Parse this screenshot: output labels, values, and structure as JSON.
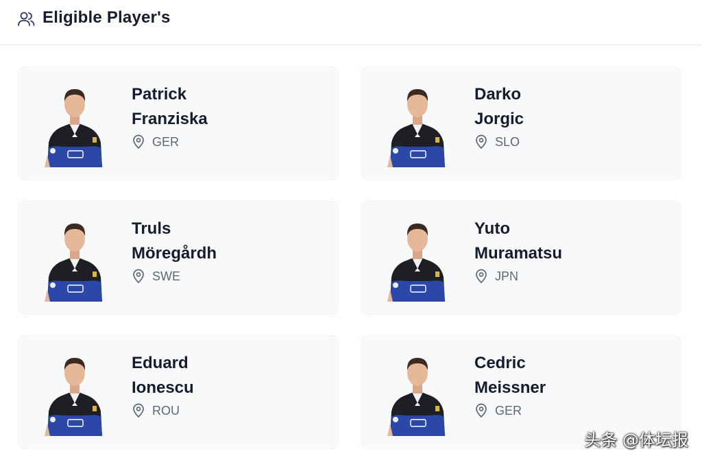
{
  "header": {
    "title": "Eligible Player's",
    "icon": "users-icon"
  },
  "colors": {
    "jersey_black": "#1d1f24",
    "jersey_blue": "#2b47a8",
    "card_bg": "#f8f9fb"
  },
  "players": [
    {
      "first": "Patrick",
      "last": "Franziska",
      "country": "GER"
    },
    {
      "first": "Darko",
      "last": "Jorgic",
      "country": "SLO"
    },
    {
      "first": "Truls",
      "last": "Möregårdh",
      "country": "SWE"
    },
    {
      "first": "Yuto",
      "last": "Muramatsu",
      "country": "JPN"
    },
    {
      "first": "Eduard",
      "last": "Ionescu",
      "country": "ROU"
    },
    {
      "first": "Cedric",
      "last": "Meissner",
      "country": "GER"
    }
  ],
  "watermark": "头条 @体坛报"
}
